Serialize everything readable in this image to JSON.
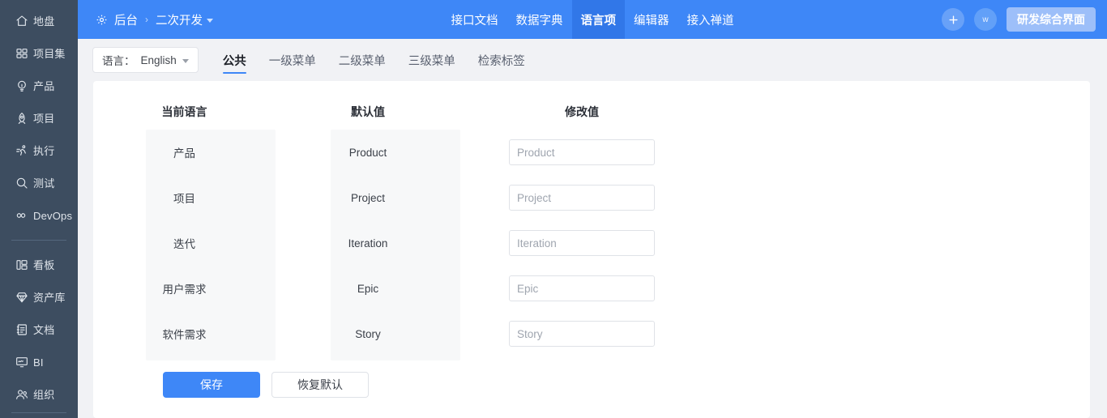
{
  "sidebar": {
    "groups": [
      {
        "items": [
          {
            "label": "地盘",
            "icon": "home-icon"
          },
          {
            "label": "项目集",
            "icon": "grid-blocks-icon"
          },
          {
            "label": "产品",
            "icon": "lightbulb-icon"
          },
          {
            "label": "项目",
            "icon": "rocket-icon"
          },
          {
            "label": "执行",
            "icon": "runner-icon"
          },
          {
            "label": "测试",
            "icon": "magnifier-icon"
          },
          {
            "label": "DevOps",
            "icon": "infinity-icon"
          }
        ]
      },
      {
        "items": [
          {
            "label": "看板",
            "icon": "kanban-icon"
          },
          {
            "label": "资产库",
            "icon": "diamond-icon"
          },
          {
            "label": "文档",
            "icon": "notebook-icon"
          },
          {
            "label": "BI",
            "icon": "monitor-chart-icon"
          },
          {
            "label": "组织",
            "icon": "people-icon"
          }
        ]
      }
    ]
  },
  "header": {
    "breadcrumb": {
      "root": "后台",
      "separator": "›",
      "current": "二次开发"
    },
    "nav": [
      {
        "label": "接口文档",
        "active": false
      },
      {
        "label": "数据字典",
        "active": false
      },
      {
        "label": "语言项",
        "active": true
      },
      {
        "label": "编辑器",
        "active": false
      },
      {
        "label": "接入禅道",
        "active": false
      }
    ],
    "avatar_initial": "w",
    "mode_button": "研发综合界面",
    "accent_color": "#3e87f7",
    "active_tab_color": "#3177e8"
  },
  "subbar": {
    "language_selector": {
      "label": "语言：",
      "value": "English"
    },
    "tabs": [
      {
        "label": "公共",
        "active": true
      },
      {
        "label": "一级菜单",
        "active": false
      },
      {
        "label": "二级菜单",
        "active": false
      },
      {
        "label": "三级菜单",
        "active": false
      },
      {
        "label": "检索标签",
        "active": false
      }
    ]
  },
  "table": {
    "headers": [
      "当前语言",
      "默认值",
      "修改值"
    ],
    "rows": [
      {
        "current": "产品",
        "default": "Product",
        "placeholder": "Product",
        "value": ""
      },
      {
        "current": "项目",
        "default": "Project",
        "placeholder": "Project",
        "value": ""
      },
      {
        "current": "迭代",
        "default": "Iteration",
        "placeholder": "Iteration",
        "value": ""
      },
      {
        "current": "用户需求",
        "default": "Epic",
        "placeholder": "Epic",
        "value": ""
      },
      {
        "current": "软件需求",
        "default": "Story",
        "placeholder": "Story",
        "value": ""
      }
    ]
  },
  "footer": {
    "save_label": "保存",
    "reset_label": "恢复默认"
  }
}
